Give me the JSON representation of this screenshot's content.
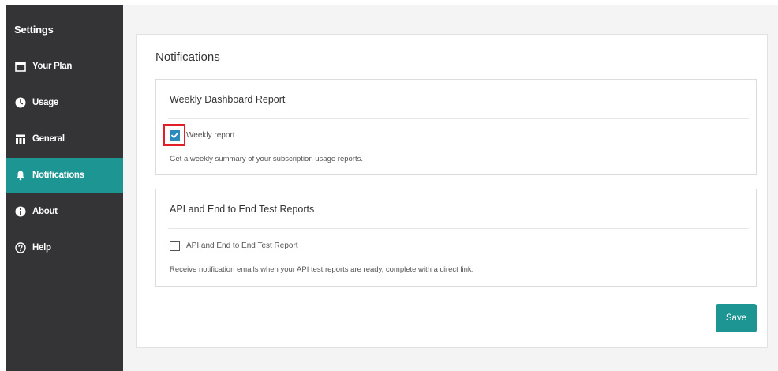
{
  "sidebar": {
    "title": "Settings",
    "items": [
      {
        "label": "Your Plan",
        "icon": "calendar-icon",
        "active": false
      },
      {
        "label": "Usage",
        "icon": "clock-icon",
        "active": false
      },
      {
        "label": "General",
        "icon": "table-icon",
        "active": false
      },
      {
        "label": "Notifications",
        "icon": "bell-icon",
        "active": true
      },
      {
        "label": "About",
        "icon": "info-icon",
        "active": false
      },
      {
        "label": "Help",
        "icon": "question-icon",
        "active": false
      }
    ]
  },
  "main": {
    "title": "Notifications",
    "sections": [
      {
        "title": "Weekly Dashboard Report",
        "checkbox_label": "Weekly report",
        "checked": true,
        "description": "Get a weekly summary of your subscription usage reports."
      },
      {
        "title": "API and End to End Test Reports",
        "checkbox_label": "API and End to End Test Report",
        "checked": false,
        "description": "Receive notification emails when your API test reports are ready, complete with a direct link."
      }
    ],
    "save_label": "Save"
  },
  "colors": {
    "sidebar_bg": "#343436",
    "accent": "#1d9593",
    "checkbox_checked": "#2b8bbf",
    "highlight": "#e01f26"
  }
}
